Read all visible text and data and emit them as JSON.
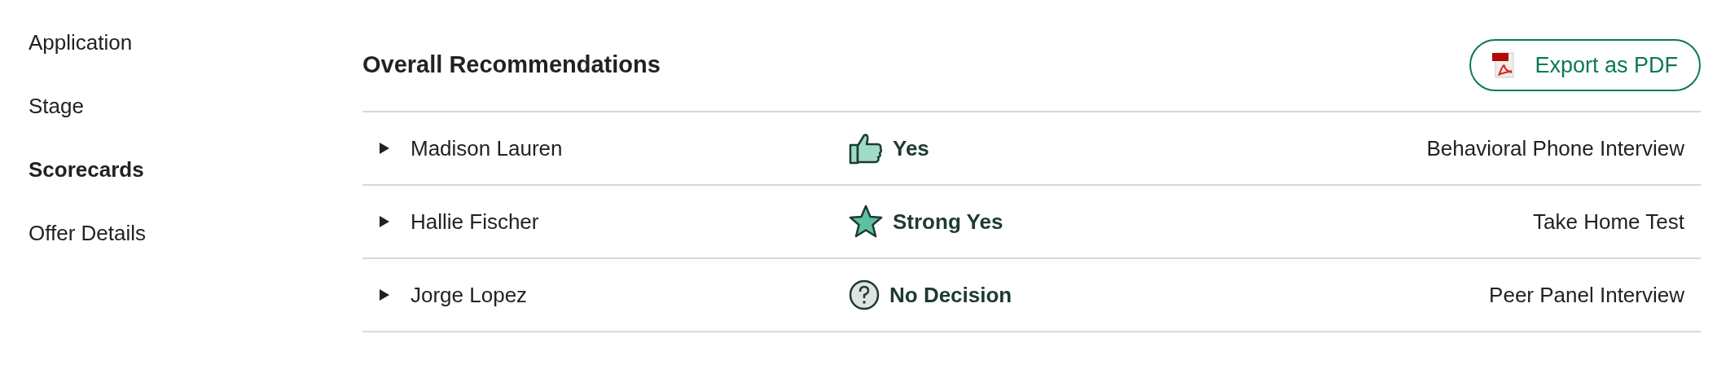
{
  "sidebar": {
    "items": [
      {
        "label": "Application",
        "selected": false
      },
      {
        "label": "Stage",
        "selected": false
      },
      {
        "label": "Scorecards",
        "selected": true
      },
      {
        "label": "Offer Details",
        "selected": false
      }
    ]
  },
  "section": {
    "title": "Overall Recommendations",
    "export_button": "Export as PDF"
  },
  "rows": [
    {
      "name": "Madison Lauren",
      "recommendation": {
        "kind": "yes",
        "label": "Yes"
      },
      "interview": "Behavioral Phone Interview",
      "expanded": false
    },
    {
      "name": "Hallie Fischer",
      "recommendation": {
        "kind": "strong_yes",
        "label": "Strong Yes"
      },
      "interview": "Take Home Test",
      "expanded": false
    },
    {
      "name": "Jorge Lopez",
      "recommendation": {
        "kind": "no_decision",
        "label": "No Decision"
      },
      "interview": "Peer Panel Interview",
      "expanded": false
    }
  ]
}
